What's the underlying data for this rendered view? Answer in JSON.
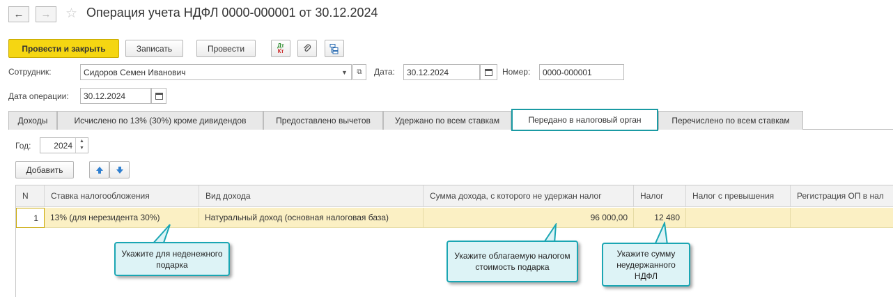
{
  "window": {
    "title": "Операция учета НДФЛ 0000-000001 от 30.12.2024"
  },
  "nav": {
    "back_icon": "arrow-left-icon",
    "forward_icon": "arrow-right-icon",
    "favorite_icon": "star-icon"
  },
  "toolbar": {
    "post_close_label": "Провести и закрыть",
    "save_label": "Записать",
    "post_label": "Провести",
    "icons": [
      "dt-kt-icon",
      "paperclip-icon",
      "structure-icon"
    ],
    "dtkt_top": "Дт",
    "dtkt_bottom": "Кт"
  },
  "form": {
    "employee_label": "Сотрудник:",
    "employee_value": "Сидоров Семен Иванович",
    "date_label": "Дата:",
    "date_value": "30.12.2024",
    "number_label": "Номер:",
    "number_value": "0000-000001",
    "op_date_label": "Дата операции:",
    "op_date_value": "30.12.2024"
  },
  "tabs": [
    {
      "label": "Доходы"
    },
    {
      "label": "Исчислено по 13% (30%) кроме дивидендов"
    },
    {
      "label": "Предоставлено вычетов"
    },
    {
      "label": "Удержано по всем ставкам"
    },
    {
      "label": "Передано в налоговый орган"
    },
    {
      "label": "Перечислено по всем ставкам"
    }
  ],
  "active_tab": "Передано в налоговый орган",
  "year": {
    "label": "Год:",
    "value": "2024"
  },
  "table_toolbar": {
    "add_label": "Добавить"
  },
  "table": {
    "columns": [
      "N",
      "Ставка налогообложения",
      "Вид дохода",
      "Сумма дохода, с которого не удержан налог",
      "Налог",
      "Налог с превышения",
      "Регистрация ОП в нал"
    ],
    "rows": [
      [
        "1",
        "13% (для нерезидента 30%)",
        "Натуральный доход (основная налоговая база)",
        "96 000,00",
        "12 480",
        "",
        ""
      ]
    ]
  },
  "callouts": [
    {
      "text": "Укажите для неденежного подарка"
    },
    {
      "text": "Укажите облагаемую налогом стоимость подарка"
    },
    {
      "text": "Укажите сумму неудержанного НДФЛ"
    }
  ],
  "colors": {
    "accent": "#1a9aa3",
    "primary_button": "#f5d612",
    "row_highlight": "#fbf0c4",
    "callout_bg": "#ddf3f6"
  }
}
